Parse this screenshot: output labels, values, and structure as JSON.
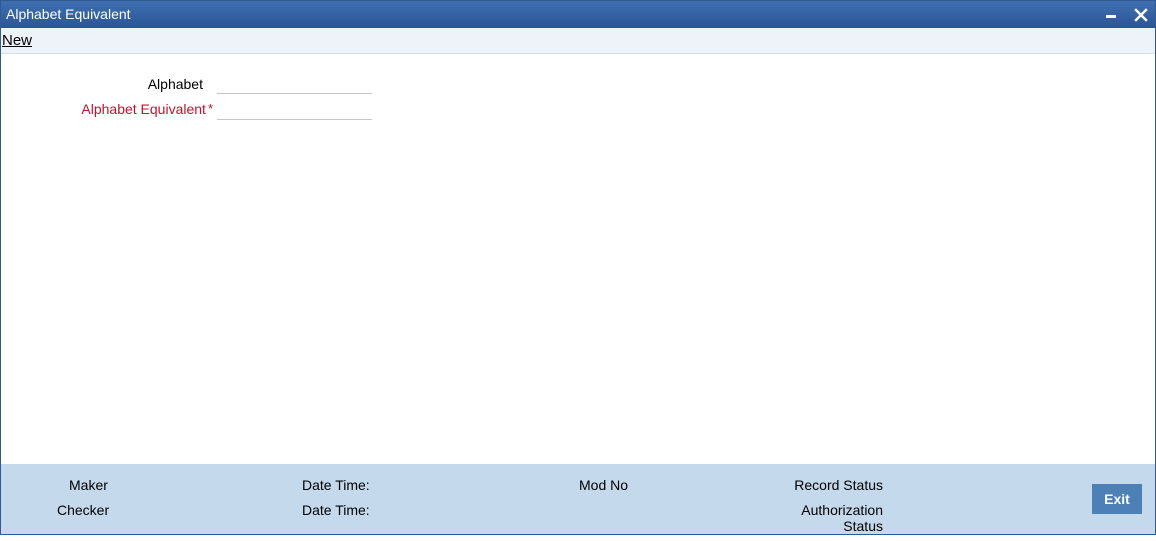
{
  "window": {
    "title": "Alphabet Equivalent",
    "minimize_icon": "minimize-icon",
    "close_icon": "close-icon"
  },
  "toolbar": {
    "new_label": "New"
  },
  "form": {
    "alphabet_label": "Alphabet",
    "alphabet_value": "",
    "equivalent_label": "Alphabet Equivalent",
    "equivalent_required_mark": "*",
    "equivalent_value": ""
  },
  "footer": {
    "maker_label": "Maker",
    "checker_label": "Checker",
    "maker_datetime_label": "Date Time:",
    "checker_datetime_label": "Date Time:",
    "mod_no_label": "Mod No",
    "record_status_label": "Record Status",
    "authorization_label": "Authorization",
    "authorization_status_label": "Status",
    "exit_label": "Exit"
  },
  "colors": {
    "titlebar": "#2b5597",
    "footer": "#c4d9ec",
    "required": "#c8102e",
    "exit_button": "#4d80b6"
  }
}
